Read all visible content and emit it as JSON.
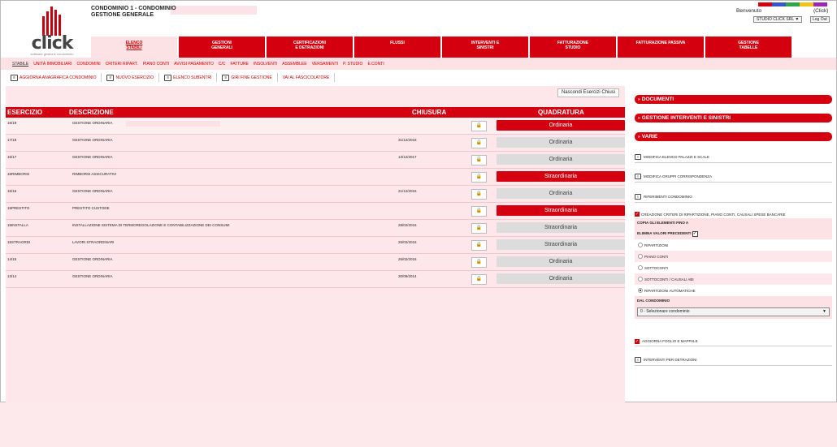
{
  "header": {
    "condo_line1": "CONDOMINIO 1 - CONDOMINIO",
    "condo_line2": "GESTIONE GENERALE",
    "welcome": "Benvenuto",
    "click_link": "(Click)",
    "studio_select": "STUDIO CLICK SRL",
    "studio_arrow": "▼",
    "logout": "Log Out",
    "logo_word": "click",
    "logo_tag": "software gestione condominio",
    "strip_colors": [
      "#d5000f",
      "#3a56c4",
      "#2fa44a",
      "#f0c419",
      "#9c27b0"
    ]
  },
  "mainnav": [
    {
      "label1": "ELENCO",
      "label2": "STABILI",
      "active": true
    },
    {
      "label1": "GESTIONI",
      "label2": "GENERALI"
    },
    {
      "label1": "CERTIFICAZIONI",
      "label2": "E DETRAZIONI"
    },
    {
      "label1": "FLUSSI",
      "label2": ""
    },
    {
      "label1": "INTERVENTI E",
      "label2": "SINISTRI"
    },
    {
      "label1": "FATTURAZIONE",
      "label2": "STUDIO"
    },
    {
      "label1": "FATTURAZIONE PASSIVA",
      "label2": ""
    },
    {
      "label1": "GESTIONE",
      "label2": "TABELLE"
    }
  ],
  "subnav": [
    "STABILE",
    "UNITÀ IMMOBILIARI",
    "CONDOMINI",
    "CRITERI RIPART.",
    "PIANO CONTI",
    "AVVISI PAGAMENTO",
    "C/C",
    "FATTURE",
    "INSOLVENTI",
    "ASSEMBLEE",
    "VERSAMENTI",
    "P. STUDIO",
    "E.CONTI"
  ],
  "toolbar": [
    {
      "label": "AGGIORNA ANAGRAFICA CONDOMINIO"
    },
    {
      "label": "NUOVO ESERCIZIO"
    },
    {
      "label": "ELENCO SUBENTRI"
    },
    {
      "label": "GIRI FINE GESTIONE"
    },
    {
      "label": "VAI AL FASCICOLATORE"
    }
  ],
  "panel": {
    "hide_button": "Nascondi Esercizi Chiusi",
    "columns": {
      "esercizio": "ESERCIZIO",
      "descrizione": "DESCRIZIONE",
      "chiusura": "CHIUSURA",
      "quadratura": "QUADRATURA"
    },
    "rows": [
      {
        "esercizio": "18/19",
        "descrizione": "GESTIONE ORDINARIA",
        "chiusura": "",
        "quadratura": "Ordinaria",
        "status": "red"
      },
      {
        "esercizio": "17/18",
        "descrizione": "GESTIONE ORDINARIA",
        "chiusura": "31/12/2018",
        "quadratura": "Ordinaria",
        "status": "grey"
      },
      {
        "esercizio": "16/17",
        "descrizione": "GESTIONE ORDINARIA",
        "chiusura": "13/12/2017",
        "quadratura": "Ordinaria",
        "status": "grey"
      },
      {
        "esercizio": "16RIMBORSI",
        "descrizione": "RIMBORSI ASSICURATIVI",
        "chiusura": "",
        "quadratura": "Straordinaria",
        "status": "red"
      },
      {
        "esercizio": "15/16",
        "descrizione": "GESTIONE ORDINARIA",
        "chiusura": "21/12/2016",
        "quadratura": "Ordinaria",
        "status": "grey"
      },
      {
        "esercizio": "15PRESTITO",
        "descrizione": "PRESTITO CUSTODE",
        "chiusura": "",
        "quadratura": "Straordinaria",
        "status": "red"
      },
      {
        "esercizio": "15INSTALLA",
        "descrizione": "INSTALLAZIONE SISTEMA DI TERMOREGOLAZIONE E CONTABILIZZAZIONE DEI CONSUMI",
        "chiusura": "28/02/2016",
        "quadratura": "Straordinaria",
        "status": "grey"
      },
      {
        "esercizio": "15STRAORDI",
        "descrizione": "LAVORI STRAORDINARI",
        "chiusura": "26/02/2016",
        "quadratura": "Straordinaria",
        "status": "grey"
      },
      {
        "esercizio": "14/15",
        "descrizione": "GESTIONE ORDINARIA",
        "chiusura": "26/02/2016",
        "quadratura": "Ordinaria",
        "status": "grey"
      },
      {
        "esercizio": "13/14",
        "descrizione": "GESTIONE ORDINARIA",
        "chiusura": "30/09/2014",
        "quadratura": "Ordinaria",
        "status": "grey"
      }
    ]
  },
  "right": {
    "documenti": "DOCUMENTI",
    "interventi": "GESTIONE INTERVENTI E SINISTRI",
    "varie": "VARIE",
    "items": {
      "palazzi": "MODIFICA ELENCO PALAZZI E SCALE",
      "gruppi": "MODIFICA GRUPPI CORRISPONDENZA",
      "riferimenti": "RIFERIMENTI CONDOMINIO",
      "foglio": "AGGIORNA FOGLIO E MAPPALE",
      "detrazioni": "INTERVENTI PER DETRAZIONI"
    },
    "criteri": {
      "title": "CREAZIONE CRITERI DI RIPARTIZIONE, PIANO CONTI, CAUSALI SPESE BANCARIE",
      "copia": "COPIA GLI ELEMENTI FINO A",
      "elimina": "ELIMINA VALORI PRECEDENTI",
      "options": [
        "RIPARTIZIONI",
        "PIANO CONTI",
        "SOTTOCONTI",
        "SOTTOCONTI / CAUSALI ABI",
        "RIPARTIZIONI AUTOMATICHE"
      ],
      "dal": "DAL CONDOMINIO",
      "select_value": "0 - Selezionare condominio",
      "select_arrow": "▼"
    }
  }
}
